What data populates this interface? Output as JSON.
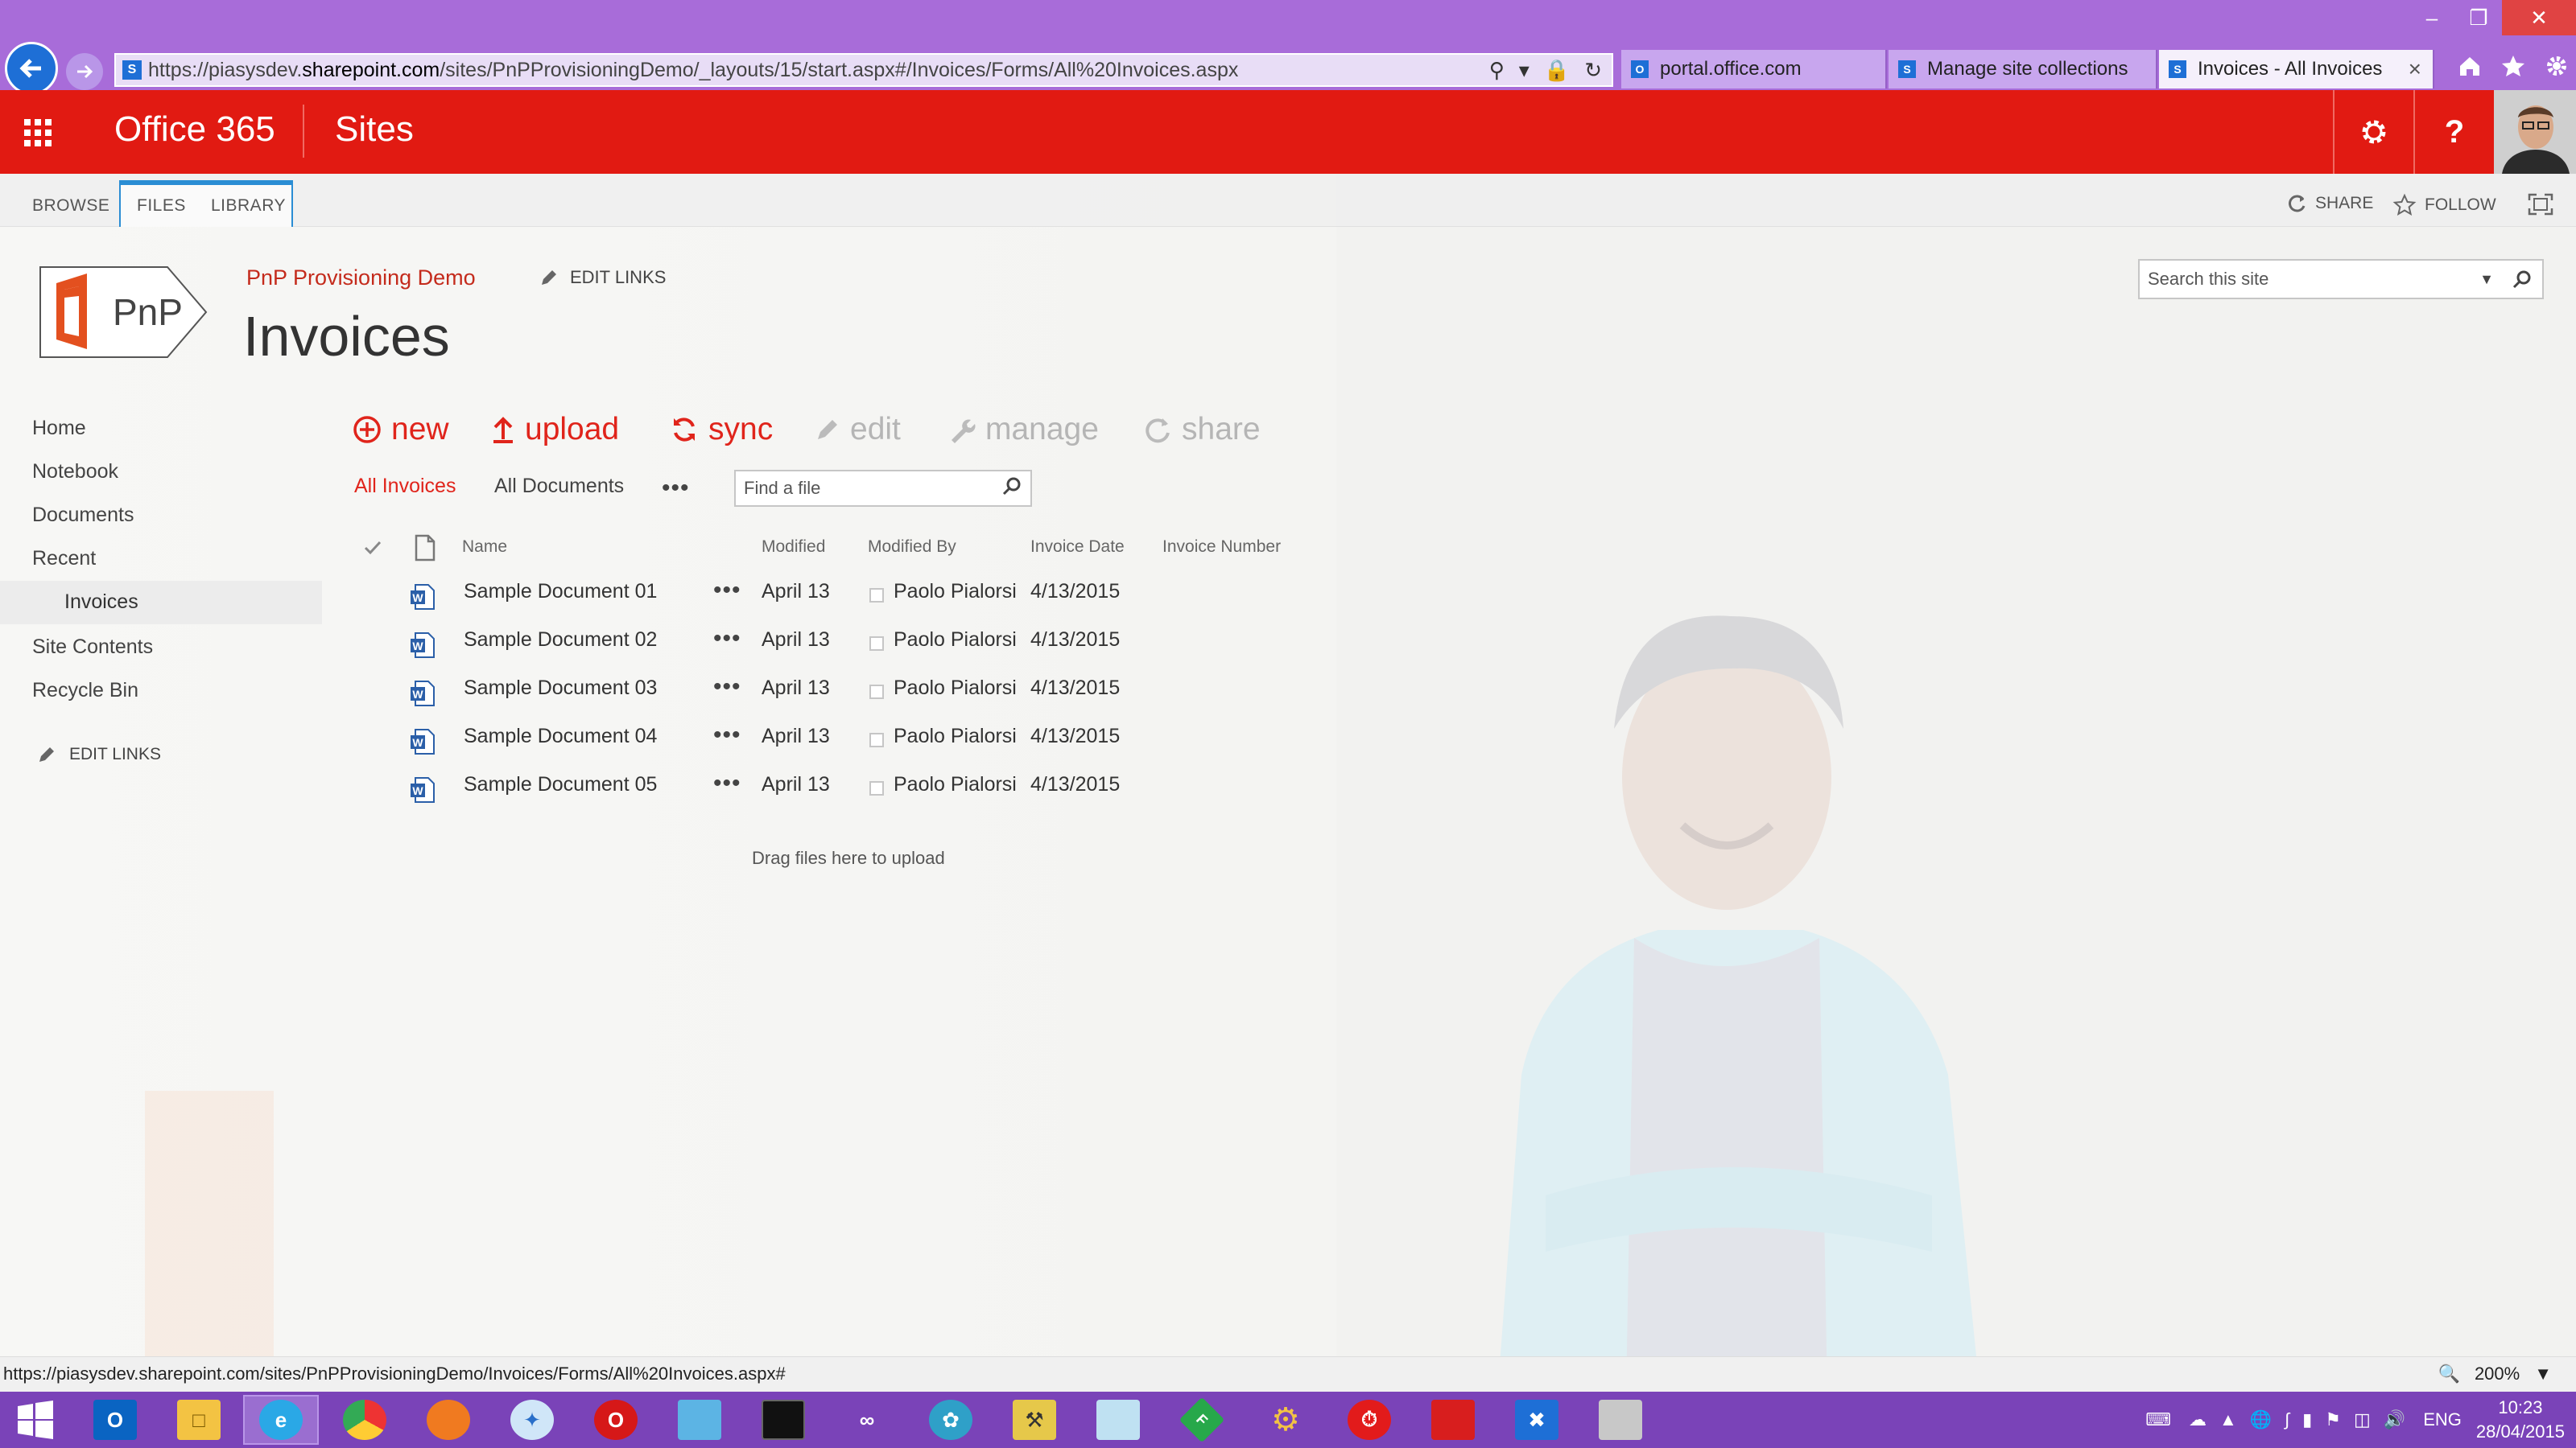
{
  "browser": {
    "url_host_prefix": "https://piasysdev.",
    "url_host": "sharepoint.com",
    "url_path": "/sites/PnPProvisioningDemo/_layouts/15/start.aspx#/Invoices/Forms/All%20Invoices.aspx",
    "tabs": [
      {
        "label": "portal.office.com",
        "active": false
      },
      {
        "label": "Manage site collections",
        "active": false
      },
      {
        "label": "Invoices - All Invoices",
        "active": true
      }
    ],
    "status_url": "https://piasysdev.sharepoint.com/sites/PnPProvisioningDemo/Invoices/Forms/All%20Invoices.aspx#",
    "zoom": "200%"
  },
  "suitebar": {
    "brand": "Office 365",
    "app": "Sites",
    "accent": "#e11a12"
  },
  "ribbon": {
    "tabs": [
      "BROWSE",
      "FILES",
      "LIBRARY"
    ],
    "share": "SHARE",
    "follow": "FOLLOW"
  },
  "header": {
    "logo_text": "PnP",
    "site_title": "PnP Provisioning Demo",
    "edit_links": "EDIT LINKS",
    "page_title": "Invoices",
    "search_placeholder": "Search this site"
  },
  "nav": {
    "items": [
      "Home",
      "Notebook",
      "Documents",
      "Recent",
      "Invoices",
      "Site Contents",
      "Recycle Bin"
    ],
    "selected": "Invoices",
    "edit_links": "EDIT LINKS"
  },
  "commands": {
    "new": "new",
    "upload": "upload",
    "sync": "sync",
    "edit": "edit",
    "manage": "manage",
    "share": "share"
  },
  "views": {
    "current": "All Invoices",
    "other": "All Documents",
    "more": "•••",
    "find_placeholder": "Find a file"
  },
  "list": {
    "columns": [
      "Name",
      "Modified",
      "Modified By",
      "Invoice Date",
      "Invoice Number"
    ],
    "rows": [
      {
        "name": "Sample Document 01",
        "modified": "April 13",
        "modified_by": "Paolo Pialorsi",
        "invoice_date": "4/13/2015",
        "invoice_number": ""
      },
      {
        "name": "Sample Document 02",
        "modified": "April 13",
        "modified_by": "Paolo Pialorsi",
        "invoice_date": "4/13/2015",
        "invoice_number": ""
      },
      {
        "name": "Sample Document 03",
        "modified": "April 13",
        "modified_by": "Paolo Pialorsi",
        "invoice_date": "4/13/2015",
        "invoice_number": ""
      },
      {
        "name": "Sample Document 04",
        "modified": "April 13",
        "modified_by": "Paolo Pialorsi",
        "invoice_date": "4/13/2015",
        "invoice_number": ""
      },
      {
        "name": "Sample Document 05",
        "modified": "April 13",
        "modified_by": "Paolo Pialorsi",
        "invoice_date": "4/13/2015",
        "invoice_number": ""
      }
    ],
    "row_dots": "•••",
    "drag_hint": "Drag files here to upload"
  },
  "taskbar": {
    "language": "ENG",
    "time": "10:23",
    "date": "28/04/2015"
  }
}
